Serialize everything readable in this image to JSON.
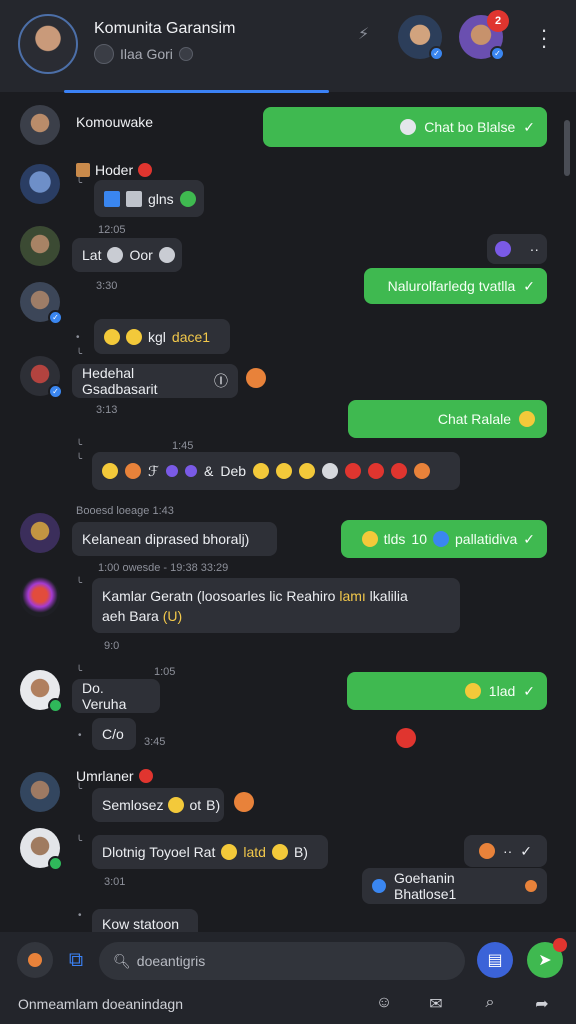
{
  "header": {
    "title": "Komunita Garansim",
    "subtitle": "Ilaa Gori",
    "notification_count": "2",
    "colors": {
      "bar": "#25272d",
      "accent": "#3b82f6"
    }
  },
  "messages": {
    "m1_name": "Komouwake",
    "m1_out": "Chat bo Blalse",
    "m2_name": "Hoder",
    "m2_text": "glns",
    "m2_time": "12:05",
    "m3_text_a": "Lat",
    "m3_text_b": "Oor",
    "m3_time": "3:30",
    "m3_out": "Nalurolfarledg tvatlla",
    "m4_text_a": "kgl",
    "m4_text_b": "dace1",
    "m5_text": "Hedehal Gsadbasarit",
    "m5_time": "3:13",
    "m5_out": "Chat Ralale",
    "m6_time": "1:45",
    "m6_text": "Deb",
    "m7_meta": "Booesd loeage 1:43",
    "m7_text": "Kelanean diprased bhoralj)",
    "m7_out_a": "tlds",
    "m7_out_b": "10",
    "m7_out_c": "pallatidiva",
    "m8_meta": "1:00 owesde - 19:38 33:29",
    "m8_text_line1": "Kamlar Geratn (loosoarles lic Reahiro",
    "m8_text_hl": "lamı",
    "m8_text_line1b": "lkalilia",
    "m8_text_line2": "aeh Bara",
    "m8_text_hl2": "(U)",
    "m8_time": "9:0",
    "m9_time_a": "1:05",
    "m9_text": "Do. Veruha",
    "m9_out": "1lad",
    "m10_text": "C/o",
    "m10_time": "3:45",
    "m11_name": "Umrlaner",
    "m11_text_a": "Semlosez",
    "m11_text_b": "ot",
    "m11_text_c": "B)",
    "m12_text_a": "Dlotnig Toyoel Rat",
    "m12_text_b": "latd",
    "m12_text_c": "B)",
    "m12_time": "3:01",
    "m12_out": "Goehanin Bhatlose1",
    "m13_text": "Kow statoon"
  },
  "bottom": {
    "search_text": "doeantigris",
    "status": "Onmeamlam doeanindagn"
  },
  "icons": {
    "header": [
      "avatar",
      "search-circle-icon",
      "bolt-icon",
      "more-vertical-icon"
    ],
    "footer": [
      "mention-icon",
      "link-icon",
      "search-icon",
      "chat-icon",
      "gift-icon",
      "sticker-icon",
      "message-icon",
      "share-icon"
    ]
  },
  "colors": {
    "background": "#1b1c20",
    "incoming": "#2e3037",
    "outgoing": "#3fb950",
    "highlight": "#f2c84b"
  }
}
